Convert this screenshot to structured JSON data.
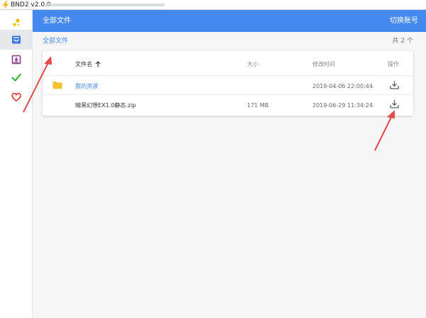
{
  "window": {
    "title": "BND2 v2.0.0"
  },
  "sidebar": {
    "items": [
      {
        "icon": "coins-icon",
        "color": "#f5b800"
      },
      {
        "icon": "inbox-icon",
        "color": "#3a78d8",
        "active": true
      },
      {
        "icon": "download-box-icon",
        "color": "#8a3a8a"
      },
      {
        "icon": "check-icon",
        "color": "#3ab43a"
      },
      {
        "icon": "heart-icon",
        "color": "#e03030"
      }
    ]
  },
  "header": {
    "title": "全部文件",
    "switch_account": "切换账号",
    "color": "#4489f0"
  },
  "main": {
    "breadcrumb": "全部文件",
    "count": "共 2 个"
  },
  "table": {
    "headers": {
      "name": "文件名",
      "size": "大小",
      "modified": "修改时间",
      "action": "操作"
    },
    "rows": [
      {
        "type": "folder",
        "name": "我的资源",
        "size": "",
        "modified": "2019-04-06 22:00:44"
      },
      {
        "type": "file",
        "name": "暗黑幻想EX1.0静态.zip",
        "size": "171 MB",
        "modified": "2019-06-29 11:34:24"
      }
    ]
  },
  "annotation_color": "#e04a4a"
}
